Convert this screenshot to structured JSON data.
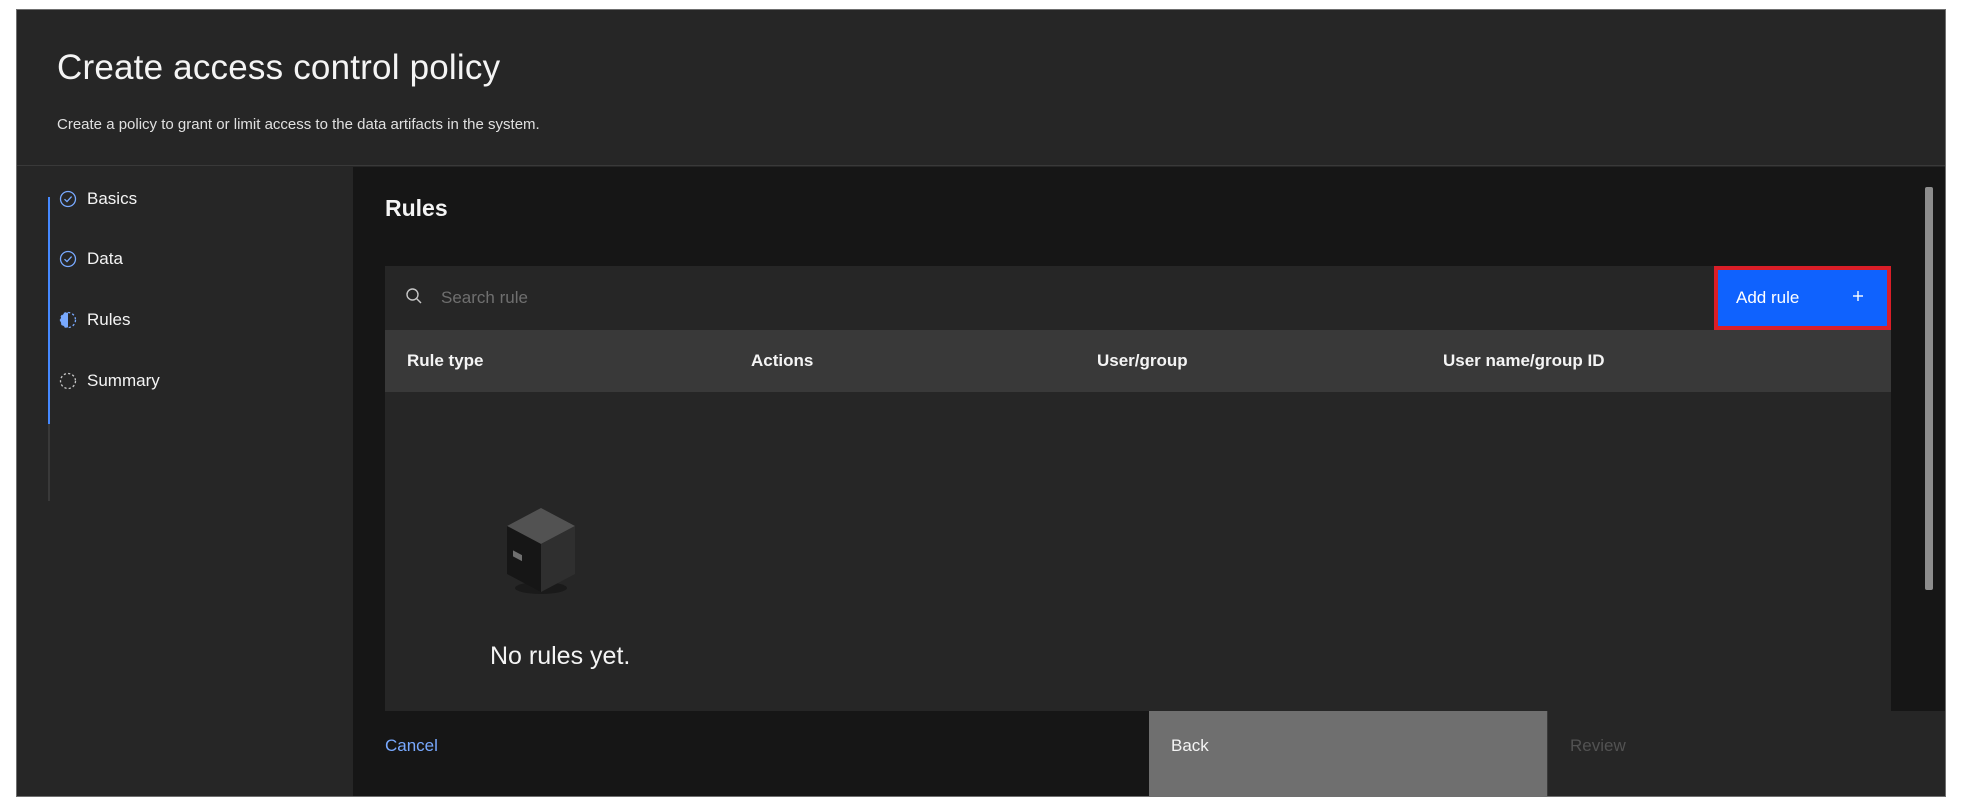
{
  "header": {
    "title": "Create access control policy",
    "subtitle": "Create a policy to grant or limit access to the data artifacts in the system."
  },
  "steps": [
    {
      "label": "Basics",
      "status": "complete",
      "icon": "checkmark-outline-icon"
    },
    {
      "label": "Data",
      "status": "complete",
      "icon": "checkmark-outline-icon"
    },
    {
      "label": "Rules",
      "status": "current",
      "icon": "incomplete-half-icon"
    },
    {
      "label": "Summary",
      "status": "incomplete",
      "icon": "circle-dash-icon"
    }
  ],
  "main": {
    "section_title": "Rules",
    "search": {
      "placeholder": "Search rule",
      "value": ""
    },
    "add_rule_label": "Add rule",
    "table": {
      "columns": [
        "Rule type",
        "Actions",
        "User/group",
        "User name/group ID"
      ]
    },
    "empty_state": {
      "text": "No rules yet.",
      "icon": "box-icon"
    }
  },
  "footer": {
    "cancel_label": "Cancel",
    "back_label": "Back",
    "review_label": "Review"
  },
  "colors": {
    "background": "#262626",
    "content_background": "#161616",
    "primary_button": "#0f62fe",
    "highlight_outline": "#da1e28",
    "link": "#78a9ff",
    "progress_active": "#4589ff"
  }
}
